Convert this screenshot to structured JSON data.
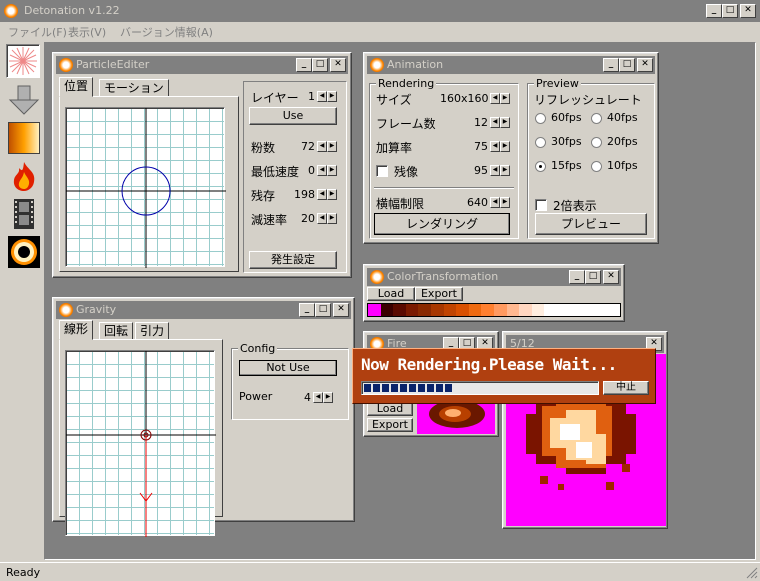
{
  "app": {
    "title": "Detonation v1.22",
    "status": "Ready"
  },
  "menu": [
    "ファイル(F)",
    "表示(V)",
    "バージョン情報(A)"
  ],
  "particle": {
    "title": "ParticleEditer",
    "tabs": [
      "位置",
      "モーション"
    ],
    "layer_label": "レイヤー",
    "layer_value": "1",
    "use_button": "Use",
    "rows": [
      {
        "label": "粉数",
        "value": "72"
      },
      {
        "label": "最低速度",
        "value": "0"
      },
      {
        "label": "残存",
        "value": "198"
      },
      {
        "label": "減速率",
        "value": "20"
      }
    ],
    "settings_button": "発生設定"
  },
  "animation": {
    "title": "Animation",
    "rendering_group": "Rendering",
    "rows": [
      {
        "label": "サイズ",
        "value": "160x160"
      },
      {
        "label": "フレーム数",
        "value": "12"
      },
      {
        "label": "加算率",
        "value": "75"
      },
      {
        "label": "残像",
        "value": "95"
      }
    ],
    "width_label": "横幅制限",
    "width_value": "640",
    "render_button": "レンダリング",
    "preview_group": "Preview",
    "refresh_label": "リフレッシュレート",
    "fps": [
      "60fps",
      "40fps",
      "30fps",
      "20fps",
      "15fps",
      "10fps"
    ],
    "fps_selected": "15fps",
    "double_label": "2倍表示",
    "preview_button": "プレビュー"
  },
  "color": {
    "title": "ColorTransformation",
    "load": "Load",
    "export": "Export",
    "swatches": [
      "#ff00ff",
      "#3a0000",
      "#5a0a00",
      "#7a1a00",
      "#8a2a00",
      "#a83800",
      "#c04400",
      "#d85000",
      "#ee6a10",
      "#ff8030",
      "#ff9a60",
      "#ffb890",
      "#ffd6c0",
      "#ffeee0",
      "#ffffff",
      "#ffffff",
      "#ffffff",
      "#ffffff",
      "#ffffff",
      "#ffffff"
    ]
  },
  "gravity": {
    "title": "Gravity",
    "tabs": [
      "線形",
      "回転",
      "引力"
    ],
    "config_group": "Config",
    "not_use_button": "Not Use",
    "power_label": "Power",
    "power_value": "4"
  },
  "fire": {
    "title": "Fire",
    "load": "Load",
    "export": "Export"
  },
  "frame": {
    "title": "5/12"
  },
  "render_dialog": {
    "message": "Now Rendering.Please Wait...",
    "cancel": "中止",
    "progress": 0.38
  },
  "colors": {
    "accent": "#0a246a",
    "magenta": "#ff00ff",
    "dialog_bg": "#b04010"
  }
}
